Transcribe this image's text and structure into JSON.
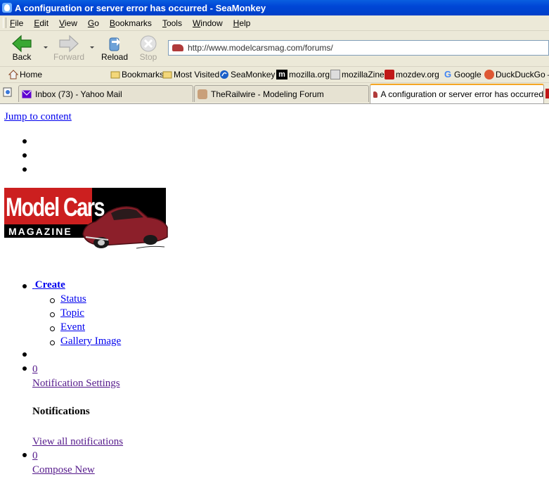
{
  "window": {
    "title": "A configuration or server error has occurred - SeaMonkey"
  },
  "menu": {
    "items": [
      "File",
      "Edit",
      "View",
      "Go",
      "Bookmarks",
      "Tools",
      "Window",
      "Help"
    ]
  },
  "toolbar": {
    "back_label": "Back",
    "forward_label": "Forward",
    "reload_label": "Reload",
    "stop_label": "Stop"
  },
  "urlbar": {
    "value": "http://www.modelcarsmag.com/forums/"
  },
  "bookmarks_bar": {
    "home": "Home",
    "items": [
      "Bookmarks",
      "Most Visited",
      "SeaMonkey",
      "mozilla.org",
      "mozillaZine",
      "mozdev.org",
      "Google",
      "DuckDuckGo"
    ]
  },
  "tabs": [
    {
      "label": "Inbox (73) - Yahoo Mail",
      "icon": "mail-icon"
    },
    {
      "label": "TheRailwire - Modeling Forum",
      "icon": "avatar-icon"
    },
    {
      "label": "A configuration or server error has occurred",
      "icon": "car-icon",
      "active": true
    }
  ],
  "page": {
    "jump_link": "Jump to content",
    "logo": {
      "line1": "Model Cars",
      "line2": "MAGAZINE"
    },
    "create": {
      "label": "Create",
      "items": [
        "Status",
        "Topic",
        "Event",
        "Gallery Image"
      ]
    },
    "notifications": {
      "count": "0",
      "settings_link": "Notification Settings",
      "heading": "Notifications",
      "view_all_link": "View all notifications"
    },
    "messages": {
      "count": "0",
      "compose_link": "Compose New"
    }
  },
  "colors": {
    "titlebar": "#0046d6",
    "chrome": "#ece9d8",
    "link": "#0000ee",
    "visited": "#551a8b",
    "logo_red": "#cc1f1f"
  }
}
